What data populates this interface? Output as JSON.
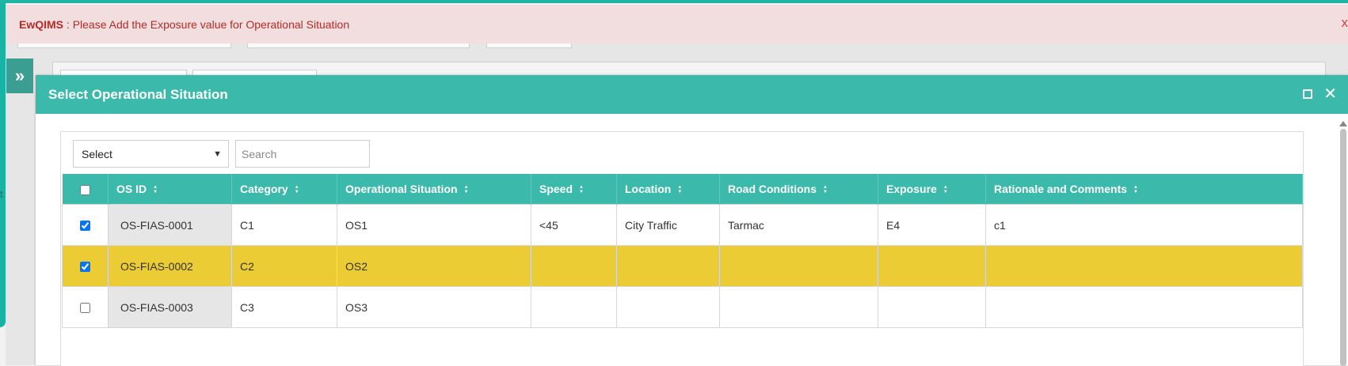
{
  "alert": {
    "app_name": "EwQIMS",
    "separator": " : ",
    "message": "Please Add the Exposure value for Operational Situation",
    "close": "x"
  },
  "sidebar": {
    "toggle_icon": "»"
  },
  "background": {
    "edge_text": "t"
  },
  "modal": {
    "title": "Select Operational Situation",
    "maximize_icon": "expand-icon",
    "close_icon": "✕"
  },
  "toolbar": {
    "select_value": "Select",
    "search_placeholder": "Search"
  },
  "table": {
    "columns": [
      "OS ID",
      "Category",
      "Operational Situation",
      "Speed",
      "Location",
      "Road Conditions",
      "Exposure",
      "Rationale and Comments"
    ],
    "rows": [
      {
        "checked": true,
        "highlighted": false,
        "cells": [
          "OS-FIAS-0001",
          "C1",
          "OS1",
          "<45",
          "City Traffic",
          "Tarmac",
          "E4",
          "c1"
        ]
      },
      {
        "checked": true,
        "highlighted": true,
        "cells": [
          "OS-FIAS-0002",
          "C2",
          "OS2",
          "",
          "",
          "",
          "",
          ""
        ]
      },
      {
        "checked": false,
        "highlighted": false,
        "cells": [
          "OS-FIAS-0003",
          "C3",
          "OS3",
          "",
          "",
          "",
          "",
          ""
        ]
      }
    ]
  },
  "colors": {
    "teal": "#3bb9aa",
    "highlight": "#ebcc34",
    "alert_bg": "#f2dede",
    "alert_text": "#b52b27"
  }
}
